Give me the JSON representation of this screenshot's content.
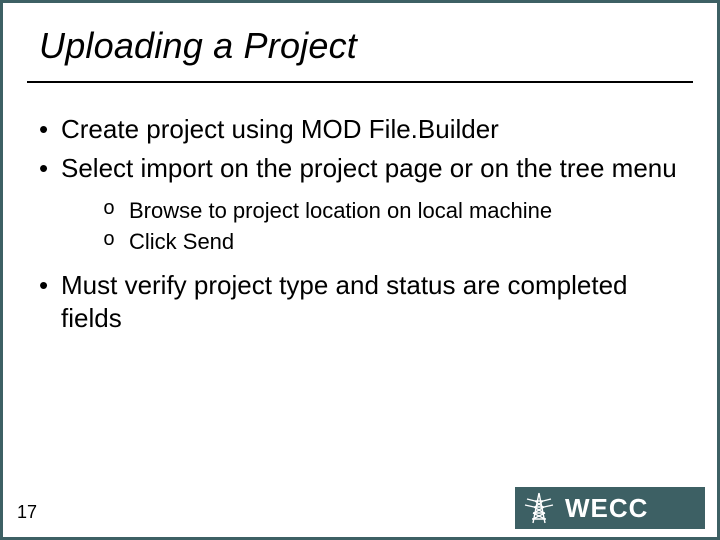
{
  "title": "Uploading a Project",
  "bullets": [
    {
      "text": "Create project using MOD File.Builder"
    },
    {
      "text": "Select import on the project page or on the tree menu",
      "sub": [
        "Browse to project location on local machine",
        "Click Send"
      ]
    },
    {
      "text": "Must verify project type and status are completed fields"
    }
  ],
  "page_number": "17",
  "logo": {
    "text": "WECC",
    "bg": "#3d6064"
  }
}
